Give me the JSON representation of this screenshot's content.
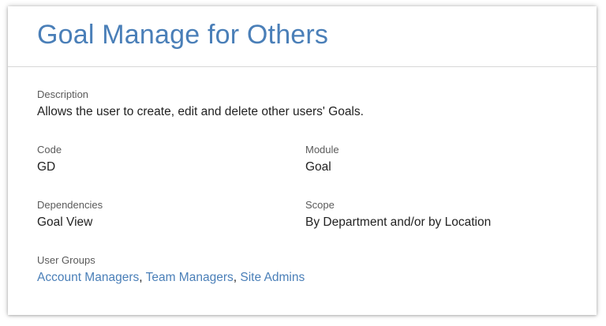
{
  "page": {
    "title": "Goal Manage for Others"
  },
  "description": {
    "label": "Description",
    "value": "Allows the user to create, edit and delete other users' Goals."
  },
  "code": {
    "label": "Code",
    "value": "GD"
  },
  "module": {
    "label": "Module",
    "value": "Goal"
  },
  "dependencies": {
    "label": "Dependencies",
    "value": "Goal View"
  },
  "scope": {
    "label": "Scope",
    "value": "By Department and/or by Location"
  },
  "user_groups": {
    "label": "User Groups",
    "items": [
      {
        "label": "Account Managers"
      },
      {
        "label": "Team Managers"
      },
      {
        "label": "Site Admins"
      }
    ],
    "separator": ", "
  },
  "colors": {
    "title": "#4a7fb8",
    "link": "#4a7fb8",
    "text": "#222222",
    "label": "#5a5a5a"
  }
}
